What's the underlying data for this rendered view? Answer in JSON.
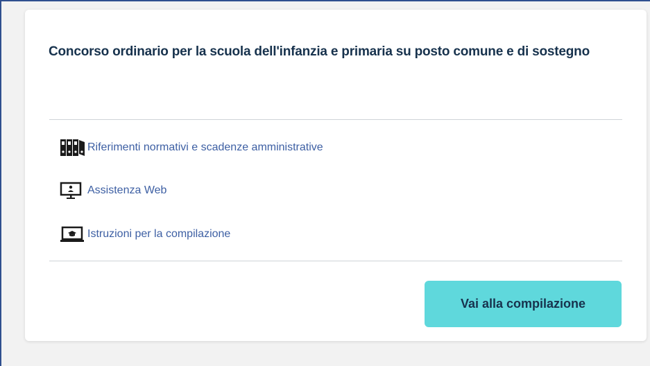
{
  "card": {
    "title": "Concorso ordinario per la scuola dell'infanzia e primaria su posto comune e di sostegno",
    "links": [
      {
        "label": "Riferimenti normativi e scadenze amministrative",
        "icon": "binders-icon"
      },
      {
        "label": "Assistenza Web",
        "icon": "monitor-person-icon"
      },
      {
        "label": "Istruzioni per la compilazione",
        "icon": "laptop-graduation-icon"
      }
    ],
    "cta_label": "Vai alla compilazione"
  },
  "colors": {
    "title": "#17324d",
    "link": "#3d5fa3",
    "button": "#5fd8dc"
  }
}
